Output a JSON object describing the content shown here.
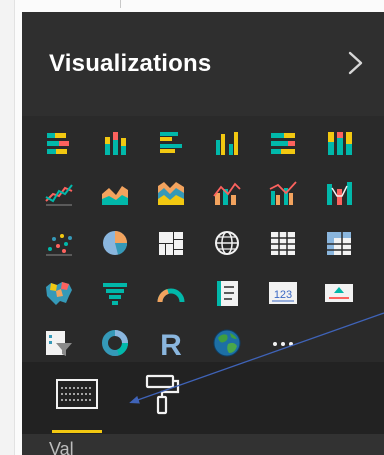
{
  "panel": {
    "title": "Visualizations",
    "collapse_icon": "chevron-right-icon"
  },
  "visual_types": [
    {
      "name": "stacked-bar-chart",
      "icon": "stacked-bar-chart-icon"
    },
    {
      "name": "stacked-column-chart",
      "icon": "stacked-column-chart-icon"
    },
    {
      "name": "clustered-bar-chart",
      "icon": "clustered-bar-chart-icon"
    },
    {
      "name": "clustered-column-chart",
      "icon": "clustered-column-chart-icon"
    },
    {
      "name": "100-percent-stacked-bar-chart",
      "icon": "100-percent-stacked-bar-chart-icon"
    },
    {
      "name": "100-percent-stacked-column-chart",
      "icon": "100-percent-stacked-column-chart-icon"
    },
    {
      "name": "line-chart",
      "icon": "line-chart-icon"
    },
    {
      "name": "area-chart",
      "icon": "area-chart-icon"
    },
    {
      "name": "stacked-area-chart",
      "icon": "stacked-area-chart-icon"
    },
    {
      "name": "line-and-stacked-column-chart",
      "icon": "line-and-stacked-column-chart-icon"
    },
    {
      "name": "line-and-clustered-column-chart",
      "icon": "line-and-clustered-column-chart-icon"
    },
    {
      "name": "ribbon-chart",
      "icon": "ribbon-chart-icon"
    },
    {
      "name": "scatter-chart",
      "icon": "scatter-chart-icon"
    },
    {
      "name": "pie-chart",
      "icon": "pie-chart-icon"
    },
    {
      "name": "treemap",
      "icon": "treemap-icon"
    },
    {
      "name": "map",
      "icon": "globe-map-icon"
    },
    {
      "name": "table",
      "icon": "table-icon"
    },
    {
      "name": "matrix",
      "icon": "matrix-icon"
    },
    {
      "name": "filled-map",
      "icon": "filled-map-icon"
    },
    {
      "name": "funnel",
      "icon": "funnel-icon"
    },
    {
      "name": "gauge",
      "icon": "gauge-icon"
    },
    {
      "name": "multi-row-card",
      "icon": "multi-row-card-icon"
    },
    {
      "name": "card",
      "icon": "card-icon",
      "text": "123"
    },
    {
      "name": "kpi",
      "icon": "kpi-icon"
    },
    {
      "name": "slicer",
      "icon": "slicer-icon"
    },
    {
      "name": "donut-chart",
      "icon": "donut-chart-icon"
    },
    {
      "name": "r-script-visual",
      "icon": "r-script-icon",
      "text": "R"
    },
    {
      "name": "arcgis-map",
      "icon": "arcgis-globe-icon"
    },
    {
      "name": "more-visuals",
      "icon": "ellipsis-icon",
      "text": "···"
    }
  ],
  "tabs": [
    {
      "name": "fields",
      "icon": "fields-icon",
      "selected": true
    },
    {
      "name": "format",
      "icon": "paint-roller-icon",
      "selected": false
    }
  ],
  "section": {
    "label": "Val"
  },
  "colors": {
    "panel_background": "#2a2a2a",
    "tab_underline": "#f2c811",
    "annotation_arrow": "#3f63b8"
  }
}
